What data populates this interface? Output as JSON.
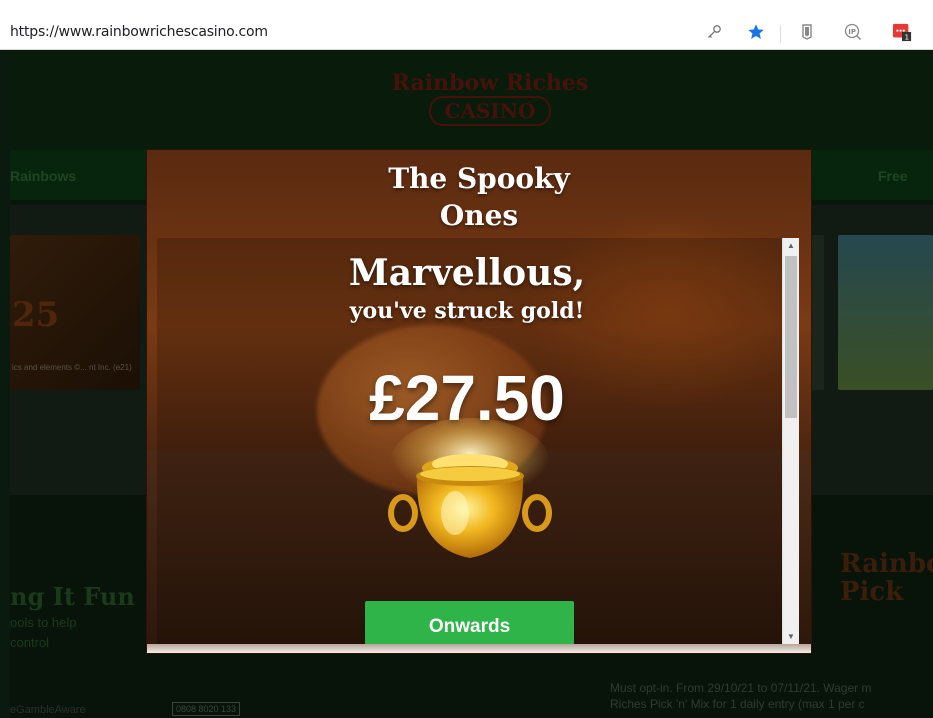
{
  "browser": {
    "url": "https://www.rainbowrichescasino.com",
    "icons": [
      "key-icon",
      "star-icon",
      "shield-icon",
      "ip-icon",
      "extension-icon"
    ],
    "star_color": "#1a73e8",
    "extension_badge": "1"
  },
  "site": {
    "logo_line1": "Rainbow Riches",
    "logo_line2": "CASINO",
    "nav_left": "Rainbows",
    "nav_right": "Free",
    "tile_label": "25",
    "tile_caption": "ics and elements ©... nt Inc. (e21)",
    "promo_title": "ng It Fun",
    "promo_text_1": "ools to help",
    "promo_text_2": "control",
    "pick_line1": "Rainbow",
    "pick_line2": "Pick",
    "terms_line1": "Must opt-in. From 29/10/21 to 07/11/21. Wager m",
    "terms_line2": "Riches Pick 'n' Mix for 1 daily entry (max 1 per c",
    "aware_text": "eGambleAware",
    "phone": "0808 8020 133"
  },
  "modal": {
    "game_title_line1": "The Spooky",
    "game_title_line2": "Ones",
    "headline": "Marvellous,",
    "subheadline": "you've struck gold!",
    "amount": "£27.50",
    "button_label": "Onwards",
    "accent_green": "#2fb44a"
  }
}
